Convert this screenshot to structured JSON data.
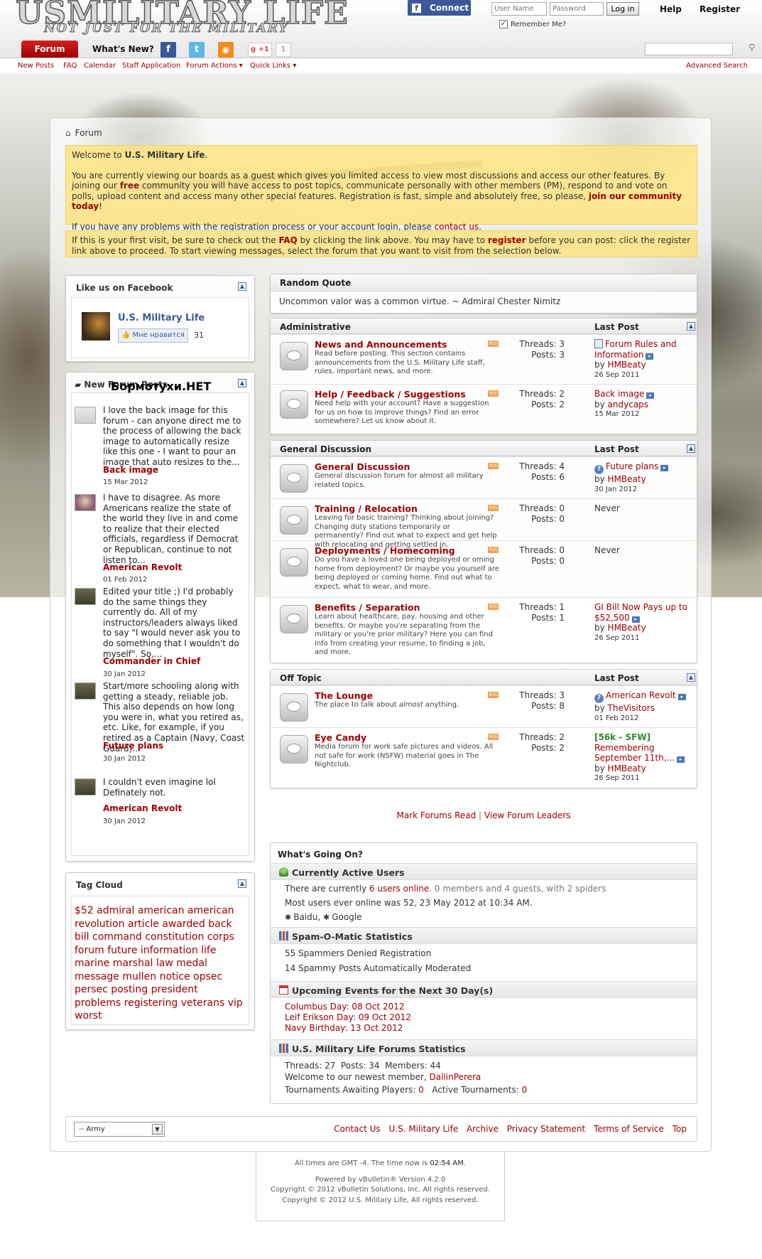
{
  "header": {
    "logo_line1": "USMILITARY LIFE",
    "logo_line2": "NOT JUST FOR THE MILITARY",
    "fb_connect": "Connect",
    "username_placeholder": "User Name",
    "password_placeholder": "Password",
    "login_label": "Log in",
    "help_label": "Help",
    "register_label": "Register",
    "remember_label": "Remember Me?",
    "tab_forum": "Forum",
    "tab_whatsnew": "What's New?",
    "gplus_label": "g +1",
    "gplus_count": "1"
  },
  "subnav": {
    "items": [
      "New Posts",
      "FAQ",
      "Calendar",
      "Staff Application",
      "Forum Actions ▾",
      "Quick Links ▾"
    ],
    "advanced_search": "Advanced Search"
  },
  "breadcrumb": "Forum",
  "notices": {
    "welcome_prefix": "Welcome to ",
    "welcome_site": "U.S. Military Life",
    "welcome_suffix": ".",
    "p2_a": "You are currently viewing our boards as a guest which gives you limited access to view most discussions and access our other features. By joining our ",
    "p2_free": "free",
    "p2_b": " community you will have access to post topics, communicate personally with other members (PM), respond to and vote on polls, upload content and access many other special features. Registration is fast, simple and absolutely free, so please, ",
    "p2_join": "join our community today",
    "p2_c": "!",
    "p3_a": "If you have any problems with the registration process or your account login, please ",
    "p3_link": "contact us",
    "p3_b": ".",
    "fv_a": "If this is your first visit, be sure to check out the ",
    "fv_faq": "FAQ",
    "fv_b": " by clicking the link above. You may have to ",
    "fv_register": "register",
    "fv_c": " before you can post: click the register link above to proceed. To start viewing messages, select the forum that you want to visit from the selection below."
  },
  "sidebar": {
    "facebook": {
      "title": "Like us on Facebook",
      "page_name": "U.S. Military Life",
      "like_label": "Мне нравится",
      "like_count": "31"
    },
    "new_posts": {
      "title": "New Forum Posts",
      "watermark": "Бормотухи.НЕТ",
      "items": [
        {
          "text": "I love the back image for this forum - can anyone direct me to the process of allowing the back image to automatically resize like this one - I want to pour an image that auto resizes to the...",
          "title": "Back image",
          "date": "15 Mar 2012"
        },
        {
          "text": "I have to disagree. As more Americans realize the state of the world they live in and come to realize that their elected officials, regardless if Democrat or Republican, continue to not listen to...",
          "title": "American Revolt",
          "date": "01 Feb 2012"
        },
        {
          "text": "Edited your title ;) I'd probably do the same things they currently do. All of my instructors/leaders always liked to say \"I would never ask you to do something that I wouldn't do myself\". So,...",
          "title": "Commander in Chief",
          "date": "30 Jan 2012"
        },
        {
          "text": "Start/more schooling along with getting a steady, reliable job. This also depends on how long you were in, what you retired as, etc. Like, for example, if you retired as a Captain (Navy, Coast Guard)...",
          "title": "Future plans",
          "date": "30 Jan 2012"
        },
        {
          "text": "I couldn't even imagine lol Definately not.",
          "title": "American Revolt",
          "date": "30 Jan 2012"
        }
      ]
    },
    "tag_cloud": {
      "title": "Tag Cloud",
      "tags": "$52 admiral american american revolution article awarded back bill command constitution corps forum future information life marine marshal law medal message mullen notice opsec persec posting president problems registering veterans vip worst"
    }
  },
  "random_quote": {
    "title": "Random Quote",
    "text": "Uncommon valor was a common virtue. ~ Admiral Chester Nimitz"
  },
  "categories": [
    {
      "title": "Administrative",
      "lastpost_label": "Last Post",
      "forums": [
        {
          "name": "News and Announcements",
          "desc": "Read before posting. This section contains announcements from the U.S. Military Life staff, rules, important news, and more.",
          "threads": "Threads: 3",
          "posts": "Posts: 3",
          "lp_title": "Forum Rules and Information",
          "lp_by": "by ",
          "lp_user": "HMBeaty",
          "lp_date": "26 Sep 2011"
        },
        {
          "name": "Help / Feedback / Suggestions",
          "desc": "Need help with your account? Have a suggestion for us on how to improve things? Find an error somewhere? Let us know about it.",
          "threads": "Threads: 2",
          "posts": "Posts: 2",
          "lp_title": "Back image",
          "lp_by": "by ",
          "lp_user": "andycaps",
          "lp_date": "15 Mar 2012"
        }
      ]
    },
    {
      "title": "General Discussion",
      "lastpost_label": "Last Post",
      "forums": [
        {
          "name": "General Discussion",
          "desc": "General discussion forum for almost all military related topics.",
          "threads": "Threads: 4",
          "posts": "Posts: 6",
          "lp_title": "Future plans",
          "lp_by": "by ",
          "lp_user": "HMBeaty",
          "lp_date": "30 Jan 2012"
        },
        {
          "name": "Training / Relocation",
          "desc": "Leaving for basic training? Thinking about joining? Changing duty stations temporarily or permanently? Find out what to expect and get help with relocating and getting settled in.",
          "threads": "Threads: 0",
          "posts": "Posts: 0",
          "lp_never": "Never"
        },
        {
          "name": "Deployments / Homecoming",
          "desc": "Do you have a loved one being deployed or oming home from deployment? Or maybe you yourself are being deployed or coming home. Find out what to expect, what to wear, and more.",
          "threads": "Threads: 0",
          "posts": "Posts: 0",
          "lp_never": "Never"
        },
        {
          "name": "Benefits / Separation",
          "desc": "Learn about healthcare, pay, housing and other benefits. Or maybe you're separating from the military or you're prior military? Here you can find info from creating your resume, to finding a job, and more.",
          "threads": "Threads: 1",
          "posts": "Posts: 1",
          "lp_title": "GI Bill Now Pays up to $52,500",
          "lp_by": "by ",
          "lp_user": "HMBeaty",
          "lp_date": "26 Sep 2011"
        }
      ]
    },
    {
      "title": "Off Topic",
      "lastpost_label": "Last Post",
      "forums": [
        {
          "name": "The Lounge",
          "desc_a": "The place to talk about ",
          "desc_em": "almost",
          "desc_b": " anything.",
          "threads": "Threads: 3",
          "posts": "Posts: 8",
          "lp_title": "American Revolt",
          "lp_by": "by ",
          "lp_user": "TheVisitors",
          "lp_date": "01 Feb 2012"
        },
        {
          "name": "Eye Candy",
          "desc": "Media forum for work safe pictures and videos. All not safe for work (NSFW) material goes in The Nightclub.",
          "threads": "Threads: 2",
          "posts": "Posts: 2",
          "lp_prefix": "[56k - SFW]",
          "lp_title": "Remembering September 11th,...",
          "lp_by": "by ",
          "lp_user": "HMBeaty",
          "lp_date": "26 Sep 2011"
        }
      ]
    }
  ],
  "mark_links": {
    "mark_read": "Mark Forums Read",
    "sep": " | ",
    "leaders": "View Forum Leaders"
  },
  "wgo": {
    "title": "What's Going On?",
    "active_title": "Currently Active Users",
    "active_a": "There are currently ",
    "active_link": "6 users online",
    "active_b": ". 0 members and 4 guests, with 2 spiders",
    "most_online": "Most users ever online was 52, 23 May 2012 at 10:34 AM.",
    "spider1": "Baidu",
    "spider2": "Google",
    "spam_title": "Spam-O-Matic Statistics",
    "spam1": "55 Spammers Denied Registration",
    "spam2": "14 Spammy Posts Automatically Moderated",
    "events_title": "Upcoming Events for the Next 30 Day(s)",
    "events": [
      {
        "name": "Columbus Day",
        "date": ": 08 Oct 2012"
      },
      {
        "name": "Leif Erikson Day",
        "date": ": 09 Oct 2012"
      },
      {
        "name": "Navy Birthday",
        "date": ": 13 Oct 2012"
      }
    ],
    "stats_title": "U.S. Military Life Forums Statistics",
    "stats_line": "Threads: 27  Posts: 34  Members: 44",
    "newest_a": "Welcome to our newest member, ",
    "newest_user": "DallinPerera",
    "tourn_a": "Tournaments Awaiting Players: ",
    "tourn_a_val": "0",
    "tourn_b": "   Active Tournaments: ",
    "tourn_b_val": "0"
  },
  "footer": {
    "style_select": "-- Army",
    "links": [
      "Contact Us",
      "U.S. Military Life",
      "Archive",
      "Privacy Statement",
      "Terms of Service",
      "Top"
    ],
    "time_a": "All times are GMT -4. The time now is ",
    "time_b": "02:54 AM",
    "time_c": ".",
    "powered": "Powered by vBulletin® Version 4.2.0",
    "copy1": "Copyright © 2012 vBulletin Solutions, Inc. All rights reserved.",
    "copy2": "Copyright © 2012 U.S. Military Life, All rights reserved."
  }
}
